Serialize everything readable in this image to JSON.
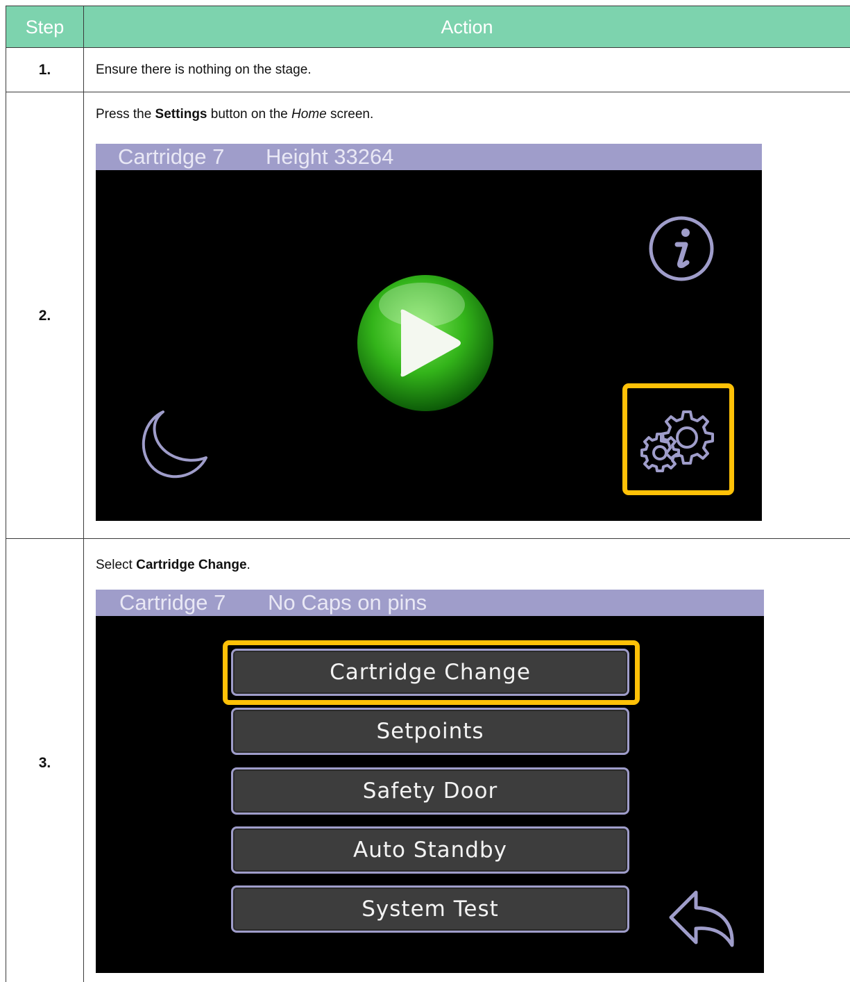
{
  "table": {
    "header": {
      "step": "Step",
      "action": "Action"
    },
    "rows": [
      {
        "step": "1.",
        "action": "Ensure there is nothing on the stage."
      },
      {
        "step": "2.",
        "instruction": {
          "pre": "Press the ",
          "bold": "Settings",
          "mid": " button on the ",
          "italic": "Home",
          "post": " screen."
        },
        "screen": {
          "bar": {
            "left": "Cartridge 7",
            "right": "Height 33264"
          },
          "icons": [
            "info-icon",
            "play-icon",
            "moon-icon",
            "gear-icon"
          ],
          "highlighted": "gear-icon"
        }
      },
      {
        "step": "3.",
        "instruction": {
          "pre": "Select ",
          "bold": "Cartridge Change",
          "post": "."
        },
        "screen": {
          "bar": {
            "left": "Cartridge 7",
            "right": "No Caps on pins"
          },
          "menu": [
            "Cartridge Change",
            "Setpoints",
            "Safety Door",
            "Auto Standby",
            "System Test"
          ],
          "highlighted": "Cartridge Change",
          "icons": [
            "back-arrow-icon"
          ]
        }
      }
    ]
  },
  "colors": {
    "header_bg": "#7dd3ae",
    "screen_bar": "#9f9dca",
    "highlight": "#ffc107",
    "button_bg": "#3d3d3d",
    "play_green": "#3db81f"
  }
}
